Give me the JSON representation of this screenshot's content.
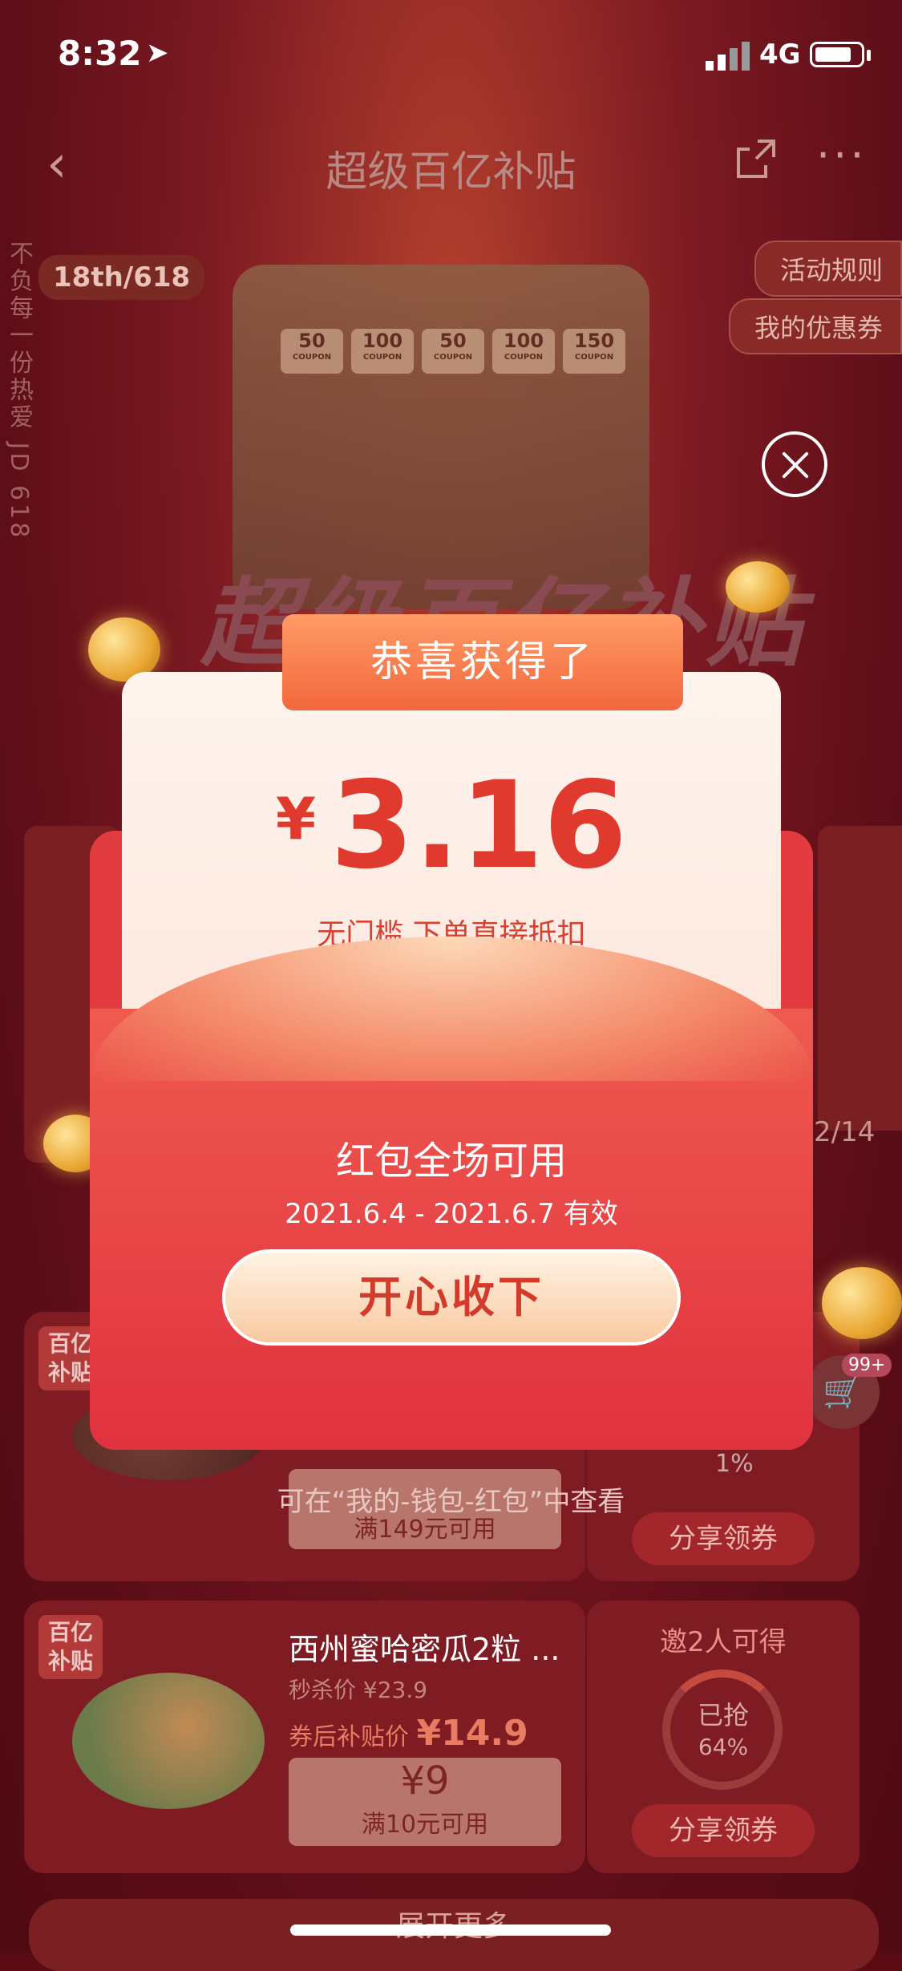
{
  "status": {
    "time": "8:32",
    "network": "4G"
  },
  "nav": {
    "title": "超级百亿补贴"
  },
  "header": {
    "tag": "18th/618",
    "side_text": "不负每一份热爱 JD 618",
    "rules": "活动规则",
    "my_coupons": "我的优惠券",
    "bg_title": "超级百亿补贴",
    "slots": [
      {
        "amount": "50",
        "label": "COUPON"
      },
      {
        "amount": "100",
        "label": "COUPON"
      },
      {
        "amount": "50",
        "label": "COUPON"
      },
      {
        "amount": "100",
        "label": "COUPON"
      },
      {
        "amount": "150",
        "label": "COUPON"
      }
    ]
  },
  "modal": {
    "ribbon": "恭喜获得了",
    "currency": "¥",
    "amount": "3.16",
    "desc": "无门槛 下单直接抵扣",
    "env_title": "红包全场可用",
    "env_date": "2021.6.4 - 2021.6.7 有效",
    "accept": "开心收下"
  },
  "hint": "可在“我的-钱包-红包”中查看",
  "pager": "2/14",
  "cart_badge": "99+",
  "products": [
    {
      "badge": "百亿补贴",
      "voucher_cond": "满149元可用",
      "side_pct": "1%",
      "share": "分享领券"
    },
    {
      "badge": "百亿补贴",
      "title": "西州蜜哈密瓜2粒 ...",
      "price_label": "秒杀价 ¥23.9",
      "after_label": "券后补贴价",
      "after_price": "¥14.9",
      "voucher_amt": "¥9",
      "voucher_cond": "满10元可用",
      "invite": "邀2人可得",
      "grabbed": "已抢",
      "grabbed_pct": "64%",
      "share": "分享领券"
    }
  ],
  "expand": "展开更多"
}
